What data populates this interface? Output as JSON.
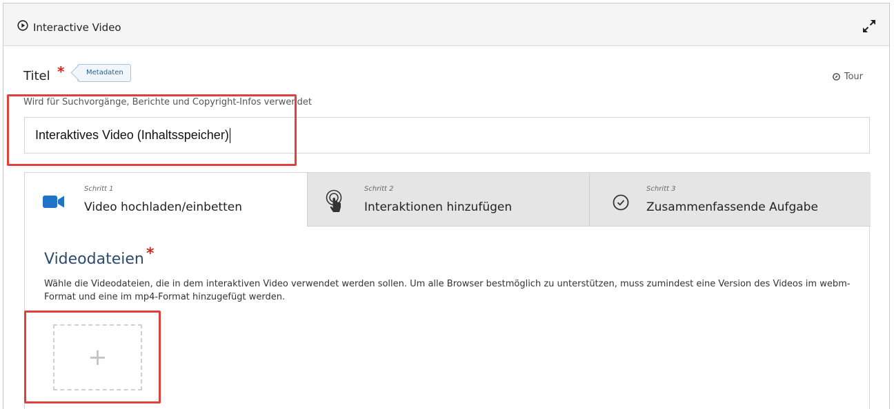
{
  "header": {
    "title": "Interactive Video"
  },
  "form": {
    "title_label": "Titel",
    "required_mark": "*",
    "metadata_button": "Metadaten",
    "tour_label": "Tour",
    "title_description": "Wird für Suchvorgänge, Berichte und Copyright-Infos verwendet",
    "title_value": "Interaktives Video (Inhaltsspeicher)"
  },
  "steps": [
    {
      "small": "Schritt 1",
      "label": "Video hochladen/einbetten",
      "icon": "video-camera-icon",
      "active": true
    },
    {
      "small": "Schritt 2",
      "label": "Interaktionen hinzufügen",
      "icon": "touch-tap-icon",
      "active": false
    },
    {
      "small": "Schritt 3",
      "label": "Zusammenfassende Aufgabe",
      "icon": "check-circle-icon",
      "active": false
    }
  ],
  "videos": {
    "title": "Videodateien",
    "required_mark": "*",
    "description": "Wähle die Videodateien, die in dem interaktiven Video verwendet werden sollen. Um alle Browser bestmöglich zu unterstützen, muss zumindest eine Version des Videos im webm-Format und eine im mp4-Format hinzugefügt werden.",
    "add_symbol": "+"
  },
  "colors": {
    "accent": "#2c4a6e",
    "required": "#d9261c",
    "highlight": "#e0403a",
    "video_icon": "#1f74c6"
  }
}
